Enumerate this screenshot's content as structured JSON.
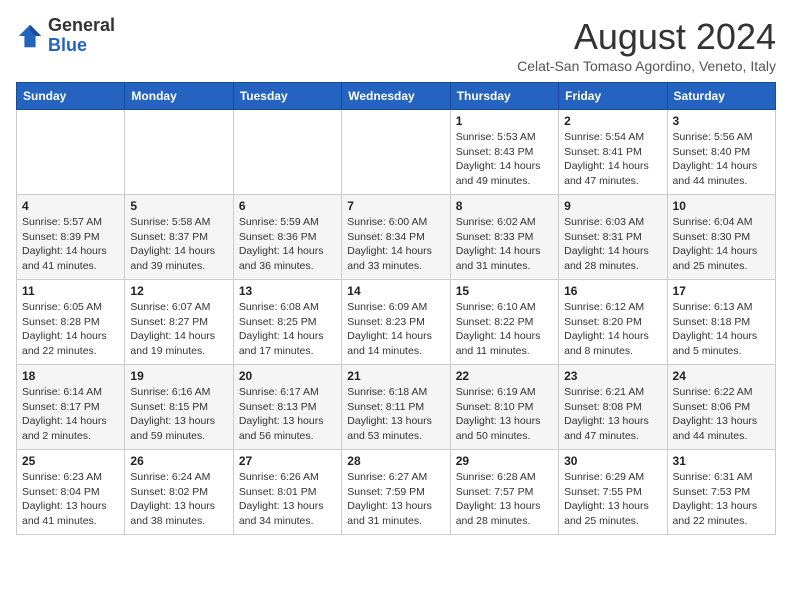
{
  "header": {
    "logo_general": "General",
    "logo_blue": "Blue",
    "month_title": "August 2024",
    "subtitle": "Celat-San Tomaso Agordino, Veneto, Italy"
  },
  "days_of_week": [
    "Sunday",
    "Monday",
    "Tuesday",
    "Wednesday",
    "Thursday",
    "Friday",
    "Saturday"
  ],
  "weeks": [
    [
      {
        "day": "",
        "info": ""
      },
      {
        "day": "",
        "info": ""
      },
      {
        "day": "",
        "info": ""
      },
      {
        "day": "",
        "info": ""
      },
      {
        "day": "1",
        "info": "Sunrise: 5:53 AM\nSunset: 8:43 PM\nDaylight: 14 hours\nand 49 minutes."
      },
      {
        "day": "2",
        "info": "Sunrise: 5:54 AM\nSunset: 8:41 PM\nDaylight: 14 hours\nand 47 minutes."
      },
      {
        "day": "3",
        "info": "Sunrise: 5:56 AM\nSunset: 8:40 PM\nDaylight: 14 hours\nand 44 minutes."
      }
    ],
    [
      {
        "day": "4",
        "info": "Sunrise: 5:57 AM\nSunset: 8:39 PM\nDaylight: 14 hours\nand 41 minutes."
      },
      {
        "day": "5",
        "info": "Sunrise: 5:58 AM\nSunset: 8:37 PM\nDaylight: 14 hours\nand 39 minutes."
      },
      {
        "day": "6",
        "info": "Sunrise: 5:59 AM\nSunset: 8:36 PM\nDaylight: 14 hours\nand 36 minutes."
      },
      {
        "day": "7",
        "info": "Sunrise: 6:00 AM\nSunset: 8:34 PM\nDaylight: 14 hours\nand 33 minutes."
      },
      {
        "day": "8",
        "info": "Sunrise: 6:02 AM\nSunset: 8:33 PM\nDaylight: 14 hours\nand 31 minutes."
      },
      {
        "day": "9",
        "info": "Sunrise: 6:03 AM\nSunset: 8:31 PM\nDaylight: 14 hours\nand 28 minutes."
      },
      {
        "day": "10",
        "info": "Sunrise: 6:04 AM\nSunset: 8:30 PM\nDaylight: 14 hours\nand 25 minutes."
      }
    ],
    [
      {
        "day": "11",
        "info": "Sunrise: 6:05 AM\nSunset: 8:28 PM\nDaylight: 14 hours\nand 22 minutes."
      },
      {
        "day": "12",
        "info": "Sunrise: 6:07 AM\nSunset: 8:27 PM\nDaylight: 14 hours\nand 19 minutes."
      },
      {
        "day": "13",
        "info": "Sunrise: 6:08 AM\nSunset: 8:25 PM\nDaylight: 14 hours\nand 17 minutes."
      },
      {
        "day": "14",
        "info": "Sunrise: 6:09 AM\nSunset: 8:23 PM\nDaylight: 14 hours\nand 14 minutes."
      },
      {
        "day": "15",
        "info": "Sunrise: 6:10 AM\nSunset: 8:22 PM\nDaylight: 14 hours\nand 11 minutes."
      },
      {
        "day": "16",
        "info": "Sunrise: 6:12 AM\nSunset: 8:20 PM\nDaylight: 14 hours\nand 8 minutes."
      },
      {
        "day": "17",
        "info": "Sunrise: 6:13 AM\nSunset: 8:18 PM\nDaylight: 14 hours\nand 5 minutes."
      }
    ],
    [
      {
        "day": "18",
        "info": "Sunrise: 6:14 AM\nSunset: 8:17 PM\nDaylight: 14 hours\nand 2 minutes."
      },
      {
        "day": "19",
        "info": "Sunrise: 6:16 AM\nSunset: 8:15 PM\nDaylight: 13 hours\nand 59 minutes."
      },
      {
        "day": "20",
        "info": "Sunrise: 6:17 AM\nSunset: 8:13 PM\nDaylight: 13 hours\nand 56 minutes."
      },
      {
        "day": "21",
        "info": "Sunrise: 6:18 AM\nSunset: 8:11 PM\nDaylight: 13 hours\nand 53 minutes."
      },
      {
        "day": "22",
        "info": "Sunrise: 6:19 AM\nSunset: 8:10 PM\nDaylight: 13 hours\nand 50 minutes."
      },
      {
        "day": "23",
        "info": "Sunrise: 6:21 AM\nSunset: 8:08 PM\nDaylight: 13 hours\nand 47 minutes."
      },
      {
        "day": "24",
        "info": "Sunrise: 6:22 AM\nSunset: 8:06 PM\nDaylight: 13 hours\nand 44 minutes."
      }
    ],
    [
      {
        "day": "25",
        "info": "Sunrise: 6:23 AM\nSunset: 8:04 PM\nDaylight: 13 hours\nand 41 minutes."
      },
      {
        "day": "26",
        "info": "Sunrise: 6:24 AM\nSunset: 8:02 PM\nDaylight: 13 hours\nand 38 minutes."
      },
      {
        "day": "27",
        "info": "Sunrise: 6:26 AM\nSunset: 8:01 PM\nDaylight: 13 hours\nand 34 minutes."
      },
      {
        "day": "28",
        "info": "Sunrise: 6:27 AM\nSunset: 7:59 PM\nDaylight: 13 hours\nand 31 minutes."
      },
      {
        "day": "29",
        "info": "Sunrise: 6:28 AM\nSunset: 7:57 PM\nDaylight: 13 hours\nand 28 minutes."
      },
      {
        "day": "30",
        "info": "Sunrise: 6:29 AM\nSunset: 7:55 PM\nDaylight: 13 hours\nand 25 minutes."
      },
      {
        "day": "31",
        "info": "Sunrise: 6:31 AM\nSunset: 7:53 PM\nDaylight: 13 hours\nand 22 minutes."
      }
    ]
  ]
}
